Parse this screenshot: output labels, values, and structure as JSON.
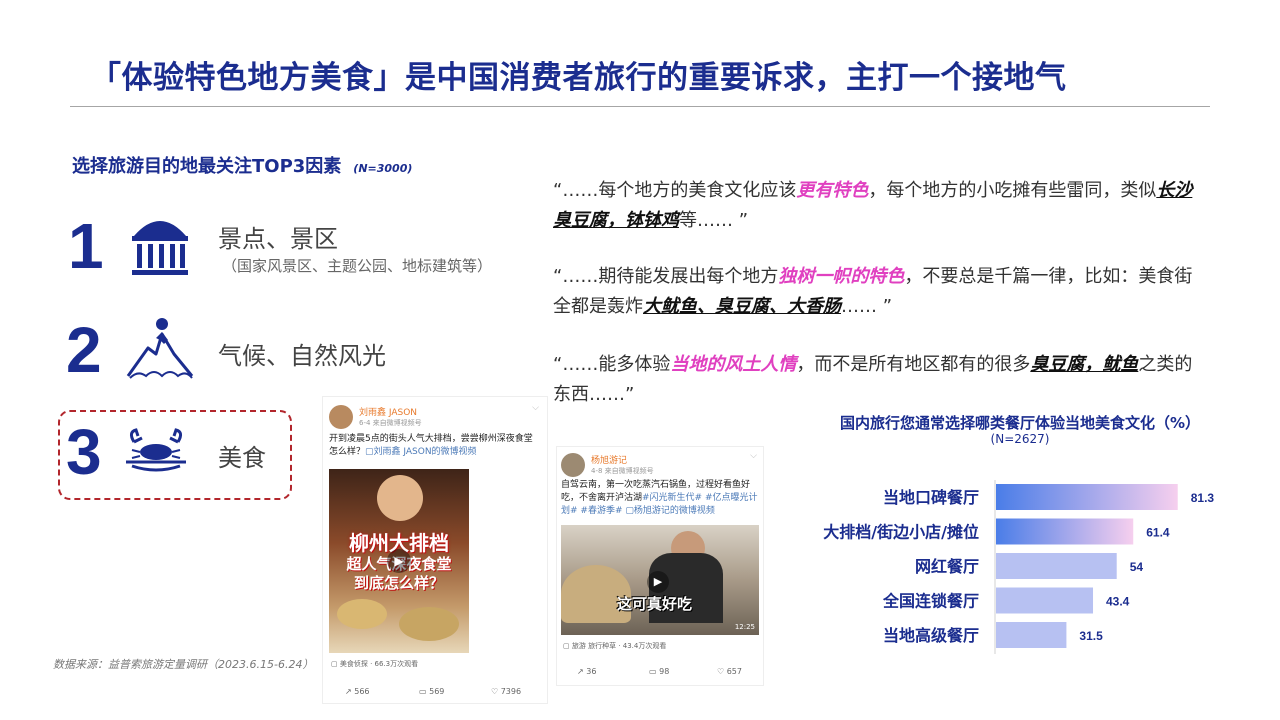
{
  "title": "「体验特色地方美食」是中国消费者旅行的重要诉求，主打一个接地气",
  "subtitle": {
    "text": "选择旅游目的地最关注TOP3因素",
    "n": "(N=3000)"
  },
  "factors": [
    {
      "rank": "1",
      "label": "景点、景区",
      "sub": "（国家风景区、主题公园、地标建筑等）",
      "icon": "museum-icon"
    },
    {
      "rank": "2",
      "label": "气候、自然风光",
      "sub": "",
      "icon": "mountain-icon"
    },
    {
      "rank": "3",
      "label": "美食",
      "sub": "",
      "icon": "crab-dish-icon"
    }
  ],
  "quotes": [
    {
      "segments": [
        {
          "t": "“……每个地方的美食文化应该",
          "s": "plain"
        },
        {
          "t": "更有特色",
          "s": "pink"
        },
        {
          "t": "，每个地方的小吃摊有些雷同，类似",
          "s": "plain"
        },
        {
          "t": "长沙臭豆腐，钵钵鸡",
          "s": "ul"
        },
        {
          "t": "等…… ”",
          "s": "plain"
        }
      ]
    },
    {
      "segments": [
        {
          "t": "“……期待能发展出每个地方",
          "s": "plain"
        },
        {
          "t": "独树一帜的特色",
          "s": "pink"
        },
        {
          "t": "，不要总是千篇一律，比如：美食街全都是轰炸",
          "s": "plain"
        },
        {
          "t": "大鱿鱼、臭豆腐、大香肠",
          "s": "ul"
        },
        {
          "t": "…… ”",
          "s": "plain"
        }
      ]
    },
    {
      "segments": [
        {
          "t": "“……能多体验",
          "s": "plain"
        },
        {
          "t": "当地的风土人情",
          "s": "pink"
        },
        {
          "t": "，而不是所有地区都有的很多",
          "s": "plain"
        },
        {
          "t": "臭豆腐，鱿鱼",
          "s": "ul"
        },
        {
          "t": "之类的东西……”",
          "s": "plain"
        }
      ]
    }
  ],
  "posts": [
    {
      "author": "刘雨鑫 JASON",
      "meta": "6-4  来自微博视频号",
      "text": "开到凌晨5点的街头人气大排档，尝尝柳州深夜食堂怎么样？",
      "link": "▢刘雨鑫 JASON的微博视频",
      "overlay1": "柳州大排档",
      "overlay2": "超人气深夜食堂",
      "overlay3": "到底怎么样？",
      "tag": "美食侦探 · 66.3万次观看",
      "share": "566",
      "comment": "569",
      "like": "7396"
    },
    {
      "author": "杨旭游记",
      "meta": "4-8  来自微博视频号",
      "text": "自驾云南，第一次吃蒸汽石锅鱼，过程好看鱼好吃，不舍离开泸沽湖",
      "link": "#闪光新生代# #亿点曝光计划# #春游季# ▢杨旭游记的微博视频",
      "caption": "这可真好吃",
      "duration": "12:25",
      "tag": "旅游 旅行种草 · 43.4万次观看",
      "share": "36",
      "comment": "98",
      "like": "657"
    }
  ],
  "chart_data": {
    "type": "bar",
    "title": "国内旅行您通常选择哪类餐厅体验当地美食文化（%）",
    "subtitle": "(N=2627)",
    "categories": [
      "当地口碑餐厅",
      "大排档/街边小店/摊位",
      "网红餐厅",
      "全国连锁餐厅",
      "当地高级餐厅"
    ],
    "values": [
      81.3,
      61.4,
      54,
      43.4,
      31.5
    ],
    "value_labels": [
      "81.3",
      "61.4",
      "54",
      "43.4",
      "31.5"
    ],
    "xlim": [
      0,
      100
    ],
    "orientation": "horizontal",
    "highlight_count": 2,
    "colors": {
      "highlight_start": "#4a7de8",
      "highlight_end": "#f6cfee",
      "normal": "#b7c1f2",
      "label": "#1b2d8f"
    }
  },
  "source": "数据来源：益普索旅游定量调研（2023.6.15-6.24）",
  "colors": {
    "brand": "#1b2d8f",
    "accent_pink": "#e040c0",
    "dashed_border": "#b2262c"
  }
}
